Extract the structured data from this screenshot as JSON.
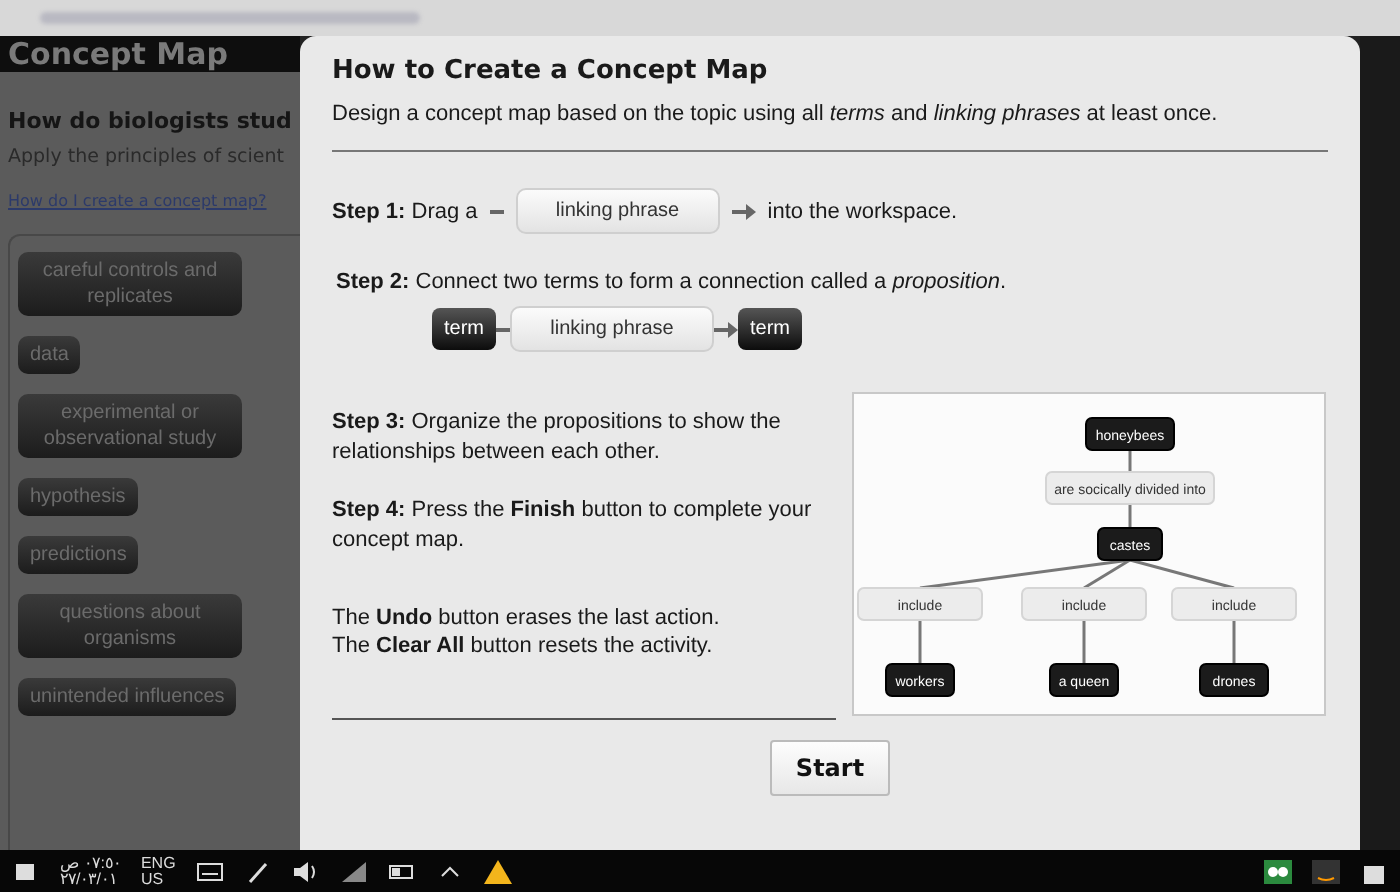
{
  "background_page": {
    "header_title": "Concept Map",
    "heading": "How do biologists stud",
    "instruction": "Apply the principles of scient",
    "help_link": "How do I create a concept map?",
    "terms": [
      "careful controls and replicates",
      "data",
      "experimental or observational study",
      "hypothesis",
      "predictions",
      "questions about organisms",
      "unintended influences"
    ]
  },
  "dialog": {
    "title": "How to Create a Concept Map",
    "intro": "Design a concept map based on the topic using all *terms* and *linking phrases* at least once.",
    "step1": {
      "before": "**Step 1:** Drag a",
      "chip": "linking phrase",
      "after": "into the workspace."
    },
    "step2": {
      "text": "**Step 2:** Connect two terms to form a connection called a *proposition*.",
      "term_a": "term",
      "link": "linking phrase",
      "term_b": "term"
    },
    "paragraphs": [
      "**Step 3:** Organize the propositions to show the relationships between each other.",
      "**Step 4:** Press the **Finish** button to complete your concept map."
    ],
    "notes": [
      "The **Undo** button erases the last action.",
      "The **Clear All** button resets the activity."
    ],
    "example_map": {
      "term": "honeybees",
      "link": "are socically divided into",
      "child": {
        "term": "castes",
        "branches": [
          {
            "link": "include",
            "term": "workers"
          },
          {
            "link": "include",
            "term": "a queen"
          },
          {
            "link": "include",
            "term": "drones"
          }
        ]
      }
    },
    "start_button": "Start"
  },
  "taskbar": {
    "time": "٠٧:٥٠ ص",
    "date": "٢٧/٠٣/٠١",
    "language": "ENG",
    "region": "US"
  }
}
